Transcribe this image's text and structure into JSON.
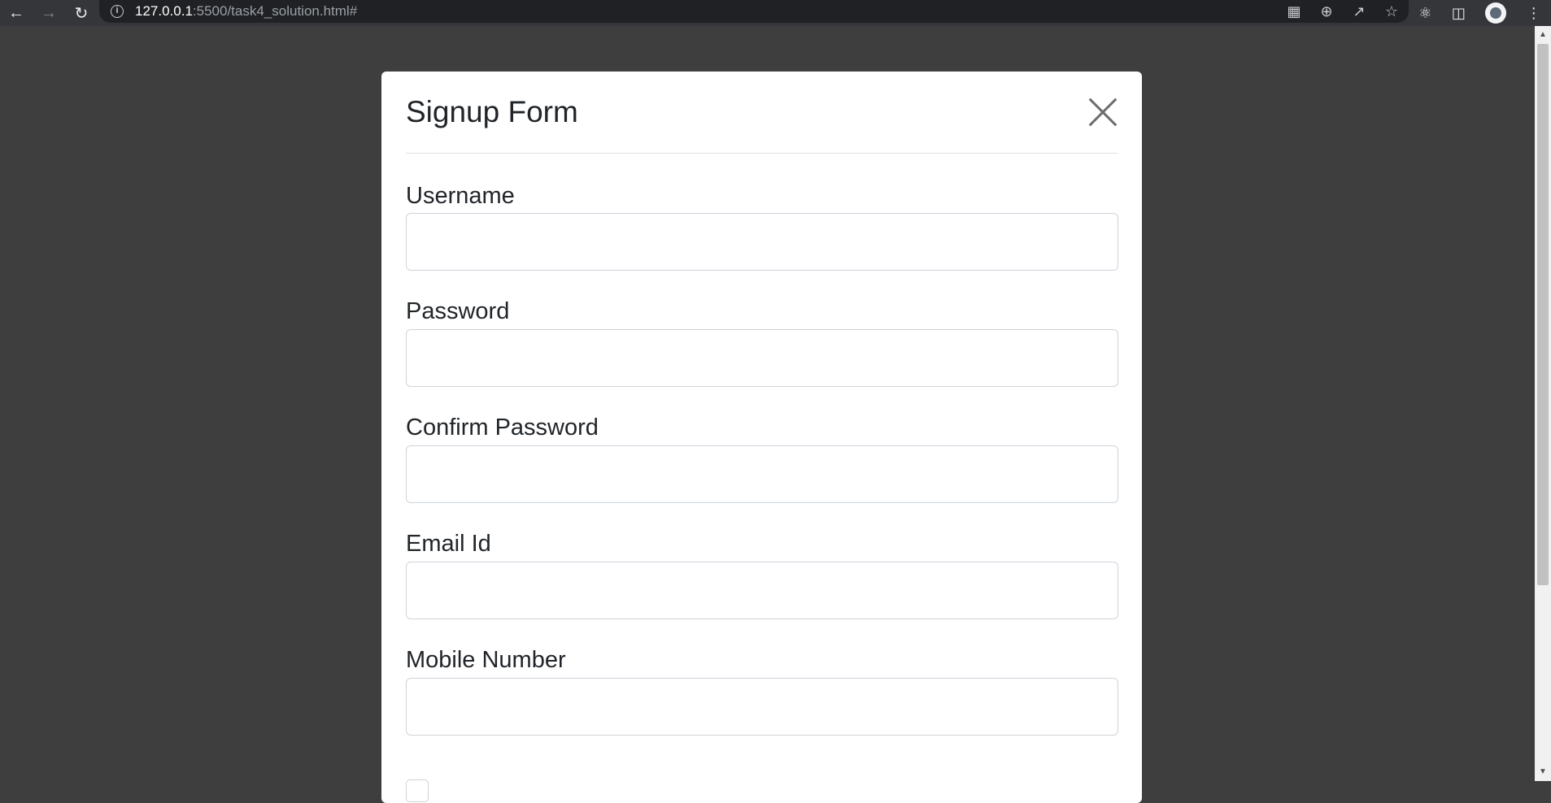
{
  "browser": {
    "url_host": "127.0.0.1",
    "url_rest": ":5500/task4_solution.html#",
    "info_icon_glyph": "i"
  },
  "modal": {
    "title": "Signup Form",
    "fields": [
      {
        "label": "Username",
        "value": "",
        "placeholder": ""
      },
      {
        "label": "Password",
        "value": "",
        "placeholder": ""
      },
      {
        "label": "Confirm Password",
        "value": "",
        "placeholder": ""
      },
      {
        "label": "Email Id",
        "value": "",
        "placeholder": ""
      },
      {
        "label": "Mobile Number",
        "value": "",
        "placeholder": ""
      }
    ]
  },
  "icons": {
    "back": "back-arrow-icon",
    "forward": "forward-arrow-icon",
    "reload": "reload-icon",
    "translate": "translate-icon",
    "zoom": "zoom-icon",
    "share": "share-icon",
    "bookmark": "star-icon",
    "extensions": "puzzle-icon",
    "sidepanel": "side-panel-icon",
    "menu": "kebab-menu-icon",
    "close": "close-icon"
  },
  "colors": {
    "page_background": "#3e3e3e",
    "modal_background": "#ffffff",
    "input_border": "#ced4da",
    "text": "#212529"
  }
}
